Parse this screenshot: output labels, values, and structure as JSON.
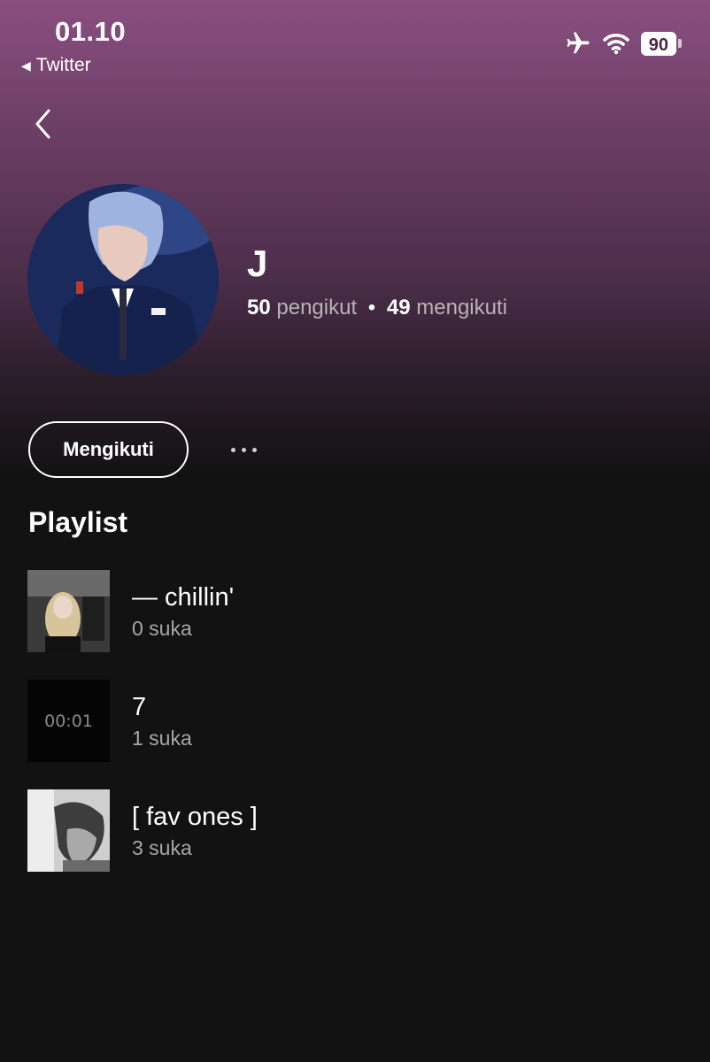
{
  "status_bar": {
    "time": "01.10",
    "back_app_label": "Twitter",
    "battery_level": "90",
    "airplane_icon": "airplane-icon",
    "wifi_icon": "wifi-icon"
  },
  "nav": {
    "back_icon": "chevron-left-icon"
  },
  "profile": {
    "name": "J",
    "followers_count": "50",
    "followers_label": "pengikut",
    "separator": "•",
    "following_count": "49",
    "following_label": "mengikuti"
  },
  "actions": {
    "follow_button_label": "Mengikuti",
    "more_icon": "more-horizontal-icon"
  },
  "playlist_section": {
    "title": "Playlist",
    "items": [
      {
        "title": "— chillin'",
        "likes": "0 suka"
      },
      {
        "title": "7",
        "likes": "1 suka",
        "thumb_text": "00:01"
      },
      {
        "title": "[ fav ones ]",
        "likes": "3 suka"
      }
    ]
  },
  "colors": {
    "gradient_top": "#8a4f80",
    "background": "#121212",
    "text_primary": "#ffffff",
    "text_secondary": "#a7a7a7"
  }
}
